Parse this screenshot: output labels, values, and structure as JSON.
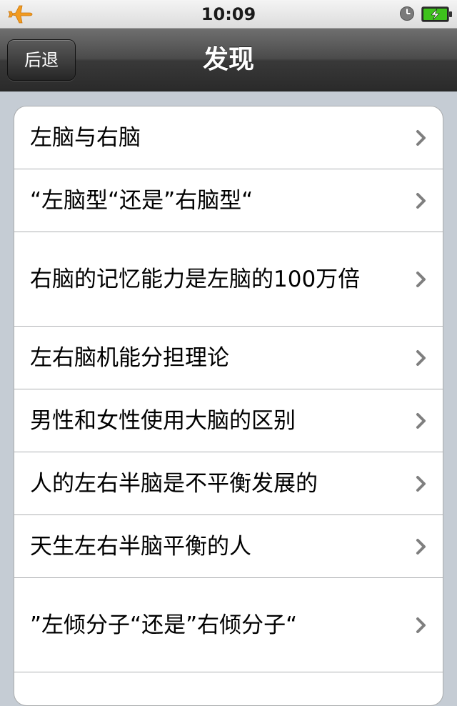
{
  "status_bar": {
    "time": "10:09",
    "left_icon": "airplane-icon",
    "right_icons": [
      "clock-icon",
      "battery-charging-icon"
    ]
  },
  "nav": {
    "back_label": "后退",
    "title": "发现"
  },
  "list": {
    "items": [
      {
        "label": "左脑与右脑"
      },
      {
        "label": "“左脑型“还是”右脑型“"
      },
      {
        "label": "右脑的记忆能力是左脑的100万倍"
      },
      {
        "label": "左右脑机能分担理论"
      },
      {
        "label": "男性和女性使用大脑的区别"
      },
      {
        "label": "人的左右半脑是不平衡发展的"
      },
      {
        "label": "天生左右半脑平衡的人"
      },
      {
        "label": "”左倾分子“还是”右倾分子“"
      }
    ]
  },
  "colors": {
    "nav_bar": "#3a3a3a",
    "background": "#c5ccd4",
    "battery_green": "#3ec21c",
    "airplane_orange": "#f29b1f"
  }
}
